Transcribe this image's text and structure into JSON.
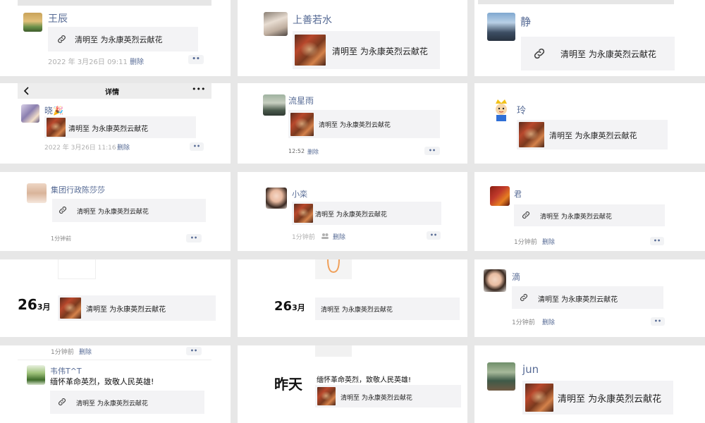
{
  "nav": {
    "title": "详情",
    "more": "•••"
  },
  "posts": [
    {
      "name": "王辰",
      "text": "清明至 为永康英烈云献花",
      "time": "2022 年 3月26日 09:11",
      "delete": "删除",
      "more": "••"
    },
    {
      "name": "上善若水",
      "text": "清明至 为永康英烈云献花"
    },
    {
      "name": "静",
      "text": "清明至 为永康英烈云献花"
    },
    {
      "name": "晓🎉",
      "text": "清明至 为永康英烈云献花",
      "time": "2022 年 3月26日 11:16",
      "delete": "删除",
      "more": "••"
    },
    {
      "name": "流星雨",
      "text": "清明至 为永康英烈云献花",
      "time": "12:52",
      "delete": "删除",
      "more": "••"
    },
    {
      "name": "玲",
      "text": "清明至 为永康英烈云献花"
    },
    {
      "name": "集团行政陈莎莎",
      "text": "清明至 为永康英烈云献花",
      "time": "1分钟前",
      "more": "••"
    },
    {
      "name": "小栾",
      "text": "清明至 为永康英烈云献花",
      "time": "1分钟前",
      "delete": "删除",
      "more": "••"
    },
    {
      "name": "君",
      "text": "清明至 为永康英烈云献花",
      "time": "1分钟前",
      "delete": "删除",
      "more": "••"
    },
    {
      "date_day": "26",
      "date_month": "3月",
      "text": "清明至 为永康英烈云献花"
    },
    {
      "date_day": "26",
      "date_month": "3月",
      "text": "清明至 为永康英烈云献花"
    },
    {
      "name": "滴",
      "text": "清明至 为永康英烈云献花",
      "time": "1分钟前",
      "delete": "删除",
      "more": "••"
    },
    {
      "top_time": "1分钟前",
      "top_delete": "删除",
      "top_more": "••",
      "name": "韦伟T^T",
      "caption": "缅怀革命英烈，致敬人民英雄!",
      "text": "清明至 为永康英烈云献花"
    },
    {
      "date_label": "昨天",
      "caption": "缅怀革命英烈，致敬人民英雄!",
      "text": "清明至 为永康英烈云献花"
    },
    {
      "name": "jun",
      "text": "清明至 为永康英烈云献花"
    }
  ]
}
